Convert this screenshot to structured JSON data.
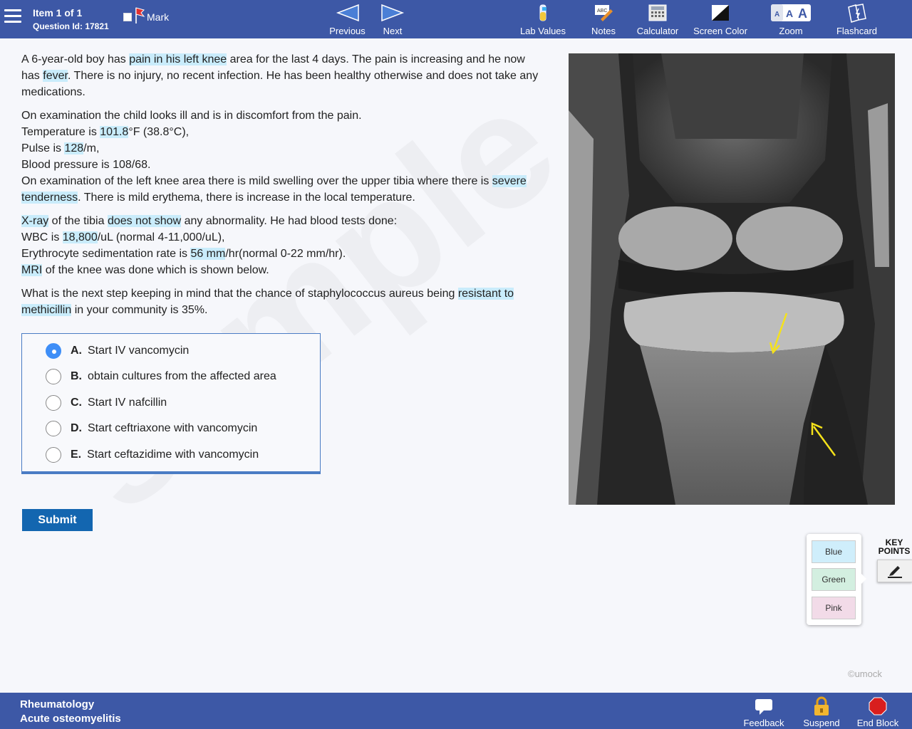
{
  "header": {
    "item_label": "Item 1 of 1",
    "question_id": "Question Id: 17821",
    "mark_label": "Mark",
    "previous_label": "Previous",
    "next_label": "Next",
    "tools": {
      "lab_values": "Lab Values",
      "notes": "Notes",
      "calculator": "Calculator",
      "screen_color": "Screen Color",
      "zoom": "Zoom",
      "flashcard": "Flashcard"
    }
  },
  "question": {
    "p1": [
      {
        "t": "A 6-year-old boy has "
      },
      {
        "t": "pain in his left knee",
        "hl": true
      },
      {
        "t": " area for the last 4 days. The pain is increasing and he now has "
      },
      {
        "t": "fever",
        "hl": true
      },
      {
        "t": ". There is no injury, no recent infection. He has been healthy otherwise and does not take any medications."
      }
    ],
    "p2_lines": [
      [
        {
          "t": "On examination the child looks ill and is in discomfort from the pain."
        }
      ],
      [
        {
          "t": "Temperature is "
        },
        {
          "t": "101.8",
          "hl": true
        },
        {
          "t": "°F (38.8°C),"
        }
      ],
      [
        {
          "t": "Pulse is "
        },
        {
          "t": "128",
          "hl": true
        },
        {
          "t": "/m,"
        }
      ],
      [
        {
          "t": "Blood pressure is 108/68."
        }
      ],
      [
        {
          "t": "On examination of the left knee area there is mild swelling over the upper tibia where there is "
        },
        {
          "t": "severe",
          "hl": true
        },
        {
          "t": " "
        },
        {
          "t": "tenderness",
          "hl": true
        },
        {
          "t": ". There is mild erythema, there is increase in the local temperature."
        }
      ]
    ],
    "p3_lines": [
      [
        {
          "t": "X-ray",
          "hl": true
        },
        {
          "t": " of the tibia "
        },
        {
          "t": "does not show",
          "hl": true
        },
        {
          "t": " any abnormality. He had blood tests done:"
        }
      ],
      [
        {
          "t": "WBC is "
        },
        {
          "t": "18,800",
          "hl": true
        },
        {
          "t": "/uL (normal 4-11,000/uL),"
        }
      ],
      [
        {
          "t": "Erythrocyte sedimentation rate is "
        },
        {
          "t": "56 mm",
          "hl": true
        },
        {
          "t": "/hr(normal 0-22 mm/hr)."
        }
      ],
      [
        {
          "t": "MRI",
          "hl": true
        },
        {
          "t": " of the knee was done which is shown below."
        }
      ]
    ],
    "p4": [
      {
        "t": "What is the next step keeping in mind that the chance of staphylococcus aureus being "
      },
      {
        "t": "resistant to methicillin",
        "hl": true
      },
      {
        "t": " in your community is 35%."
      }
    ]
  },
  "answers": [
    {
      "letter": "A.",
      "text": "Start IV vancomycin",
      "selected": true
    },
    {
      "letter": "B.",
      "text": "obtain cultures from the affected area",
      "selected": false
    },
    {
      "letter": "C.",
      "text": "Start IV nafcillin",
      "selected": false
    },
    {
      "letter": "D.",
      "text": "Start ceftriaxone with vancomycin",
      "selected": false
    },
    {
      "letter": "E.",
      "text": "Start ceftazidime with vancomycin",
      "selected": false
    }
  ],
  "submit_label": "Submit",
  "watermark": "sample",
  "highlighter": {
    "blue": "Blue",
    "green": "Green",
    "pink": "Pink",
    "key_points_line1": "KEY",
    "key_points_line2": "POINTS",
    "colors": {
      "blue": "#cfeefb",
      "green": "#d3efe0",
      "pink": "#f2dbe8"
    }
  },
  "copyright": "©umock",
  "footer": {
    "category": "Rheumatology",
    "topic": "Acute osteomyelitis",
    "feedback": "Feedback",
    "suspend": "Suspend",
    "end_block": "End Block"
  },
  "colors": {
    "header_bg": "#3d58a6",
    "highlight": "#c9ecfb",
    "submit_bg": "#1366b0",
    "radio_selected": "#3e8ef7"
  }
}
